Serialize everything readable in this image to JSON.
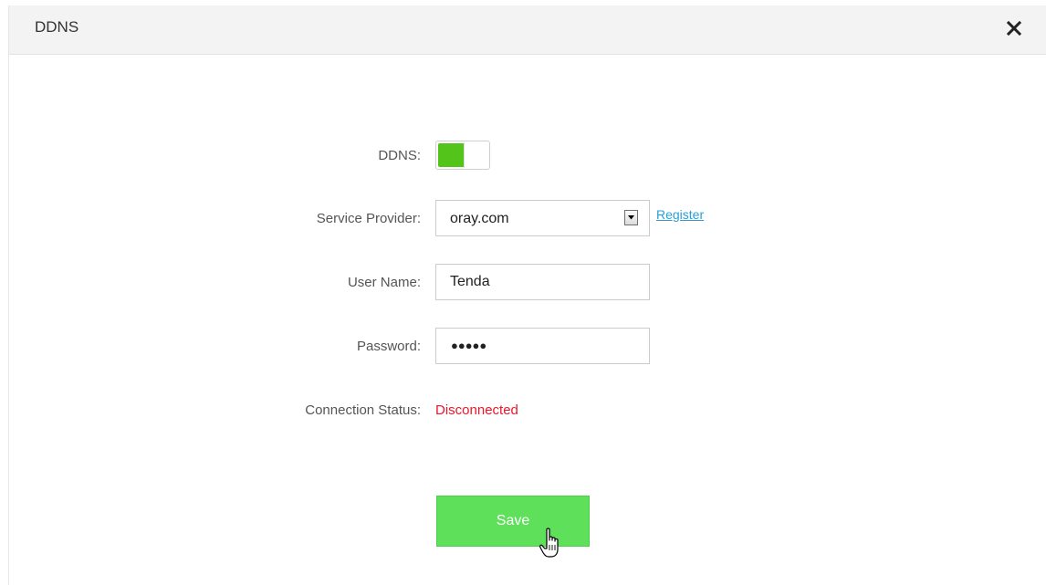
{
  "dialog": {
    "title": "DDNS",
    "close_icon": "close-icon"
  },
  "form": {
    "ddns": {
      "label": "DDNS:",
      "enabled": true,
      "accent_color": "#52c41a"
    },
    "service_provider": {
      "label": "Service Provider:",
      "value": "oray.com",
      "register_label": "Register"
    },
    "user_name": {
      "label": "User Name:",
      "value": "Tenda"
    },
    "password": {
      "label": "Password:",
      "masked_value": "●●●●●"
    },
    "connection_status": {
      "label": "Connection Status:",
      "value": "Disconnected",
      "color": "#e8172c"
    }
  },
  "actions": {
    "save_label": "Save",
    "save_color": "#5ee05a"
  },
  "cursor": {
    "icon": "hand-pointer-icon"
  }
}
